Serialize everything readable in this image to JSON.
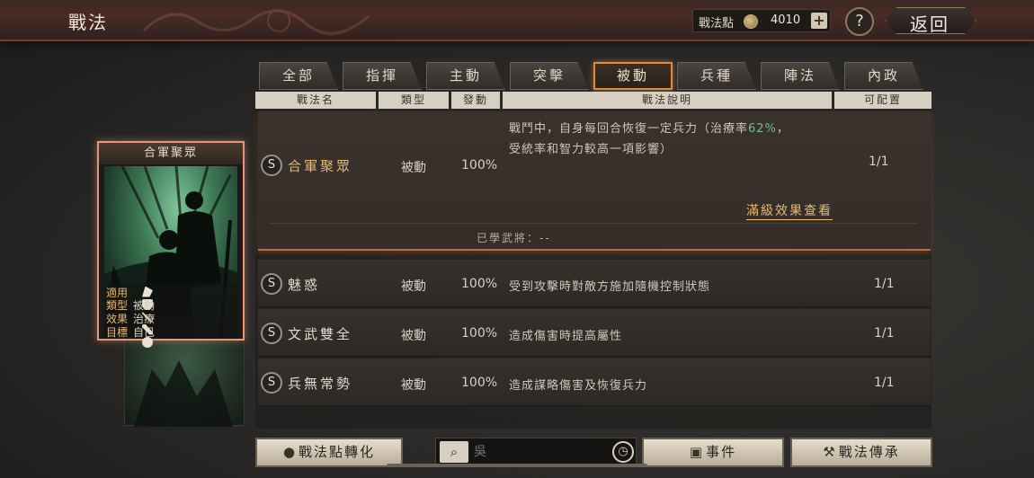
{
  "header": {
    "title": "戰法",
    "points_label": "戰法點",
    "points_value": "4010",
    "add_label": "+",
    "help_label": "?",
    "back_label": "返回"
  },
  "tabs": [
    {
      "label": "全部",
      "active": false
    },
    {
      "label": "指揮",
      "active": false
    },
    {
      "label": "主動",
      "active": false
    },
    {
      "label": "突擊",
      "active": false
    },
    {
      "label": "被動",
      "active": true
    },
    {
      "label": "兵種",
      "active": false
    },
    {
      "label": "陣法",
      "active": false
    },
    {
      "label": "內政",
      "active": false
    }
  ],
  "columns": {
    "name": "戰法名",
    "type": "類型",
    "rate": "發動",
    "desc": "戰法說明",
    "config": "可配置"
  },
  "selected_skill": {
    "badge": "S",
    "name": "合軍聚眾",
    "type": "被動",
    "rate": "100%",
    "desc_line1_a": "戰鬥中，自身每回合恢復一定兵力（治療率",
    "desc_line1_hl": "62%",
    "desc_line1_b": "，",
    "desc_line2": "受統率和智力較高一項影響）",
    "config": "1/1",
    "max_effect_link": "滿級效果查看",
    "learned_label": "已學武將：--"
  },
  "skills": [
    {
      "badge": "S",
      "name": "魅惑",
      "type": "被動",
      "rate": "100%",
      "desc": "受到攻擊時對敵方施加隨機控制狀態",
      "config": "1/1"
    },
    {
      "badge": "S",
      "name": "文武雙全",
      "type": "被動",
      "rate": "100%",
      "desc": "造成傷害時提高屬性",
      "config": "1/1"
    },
    {
      "badge": "S",
      "name": "兵無常勢",
      "type": "被動",
      "rate": "100%",
      "desc": "造成謀略傷害及恢復兵力",
      "config": "1/1"
    }
  ],
  "card": {
    "title": "合軍聚眾",
    "applicable_label": "適用",
    "type_label": "類型",
    "type_value": "被動",
    "effect_label": "效果",
    "effect_value": "治療",
    "target_label": "目標",
    "target_value": "自己",
    "applicable_icons": [
      "cavalry-icon",
      "shield-icon",
      "bow-icon",
      "spear-icon",
      "wheel-icon"
    ]
  },
  "bottom": {
    "convert_label": "戰法點轉化",
    "search_placeholder": "吳",
    "events_label": "事件",
    "inherit_label": "戰法傳承"
  },
  "colors": {
    "accent_orange": "#e08a3c",
    "gold_text": "#e6b873",
    "heal_green": "#72c08a"
  }
}
